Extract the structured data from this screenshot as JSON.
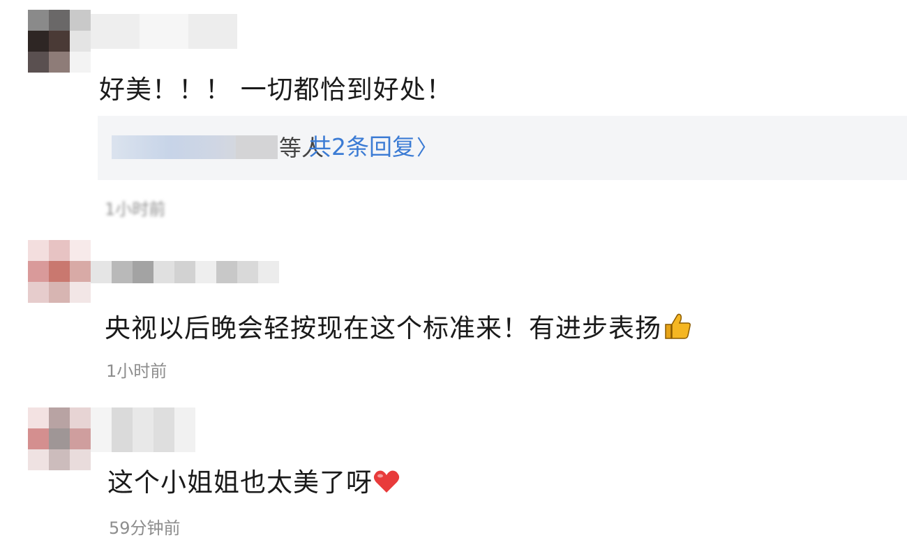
{
  "comments": [
    {
      "text": "好美！！！ 一切都恰到好处！",
      "reply": {
        "person_suffix": "等人",
        "link": "共2条回复",
        "chevron": "〉"
      },
      "time": "1小时前"
    },
    {
      "text": "央视以后晚会轻按现在这个标准来！有进步表扬",
      "emoji": "thumbs-up-icon",
      "time": "1小时前"
    },
    {
      "text": "这个小姐姐也太美了呀",
      "emoji": "heart-icon",
      "time": "59分钟前"
    }
  ],
  "colors": {
    "link": "#3b7bd4",
    "time": "#8d8d8d",
    "reply_bg": "#f4f5f7",
    "heart": "#e83b3b",
    "thumb": "#f5b622"
  }
}
